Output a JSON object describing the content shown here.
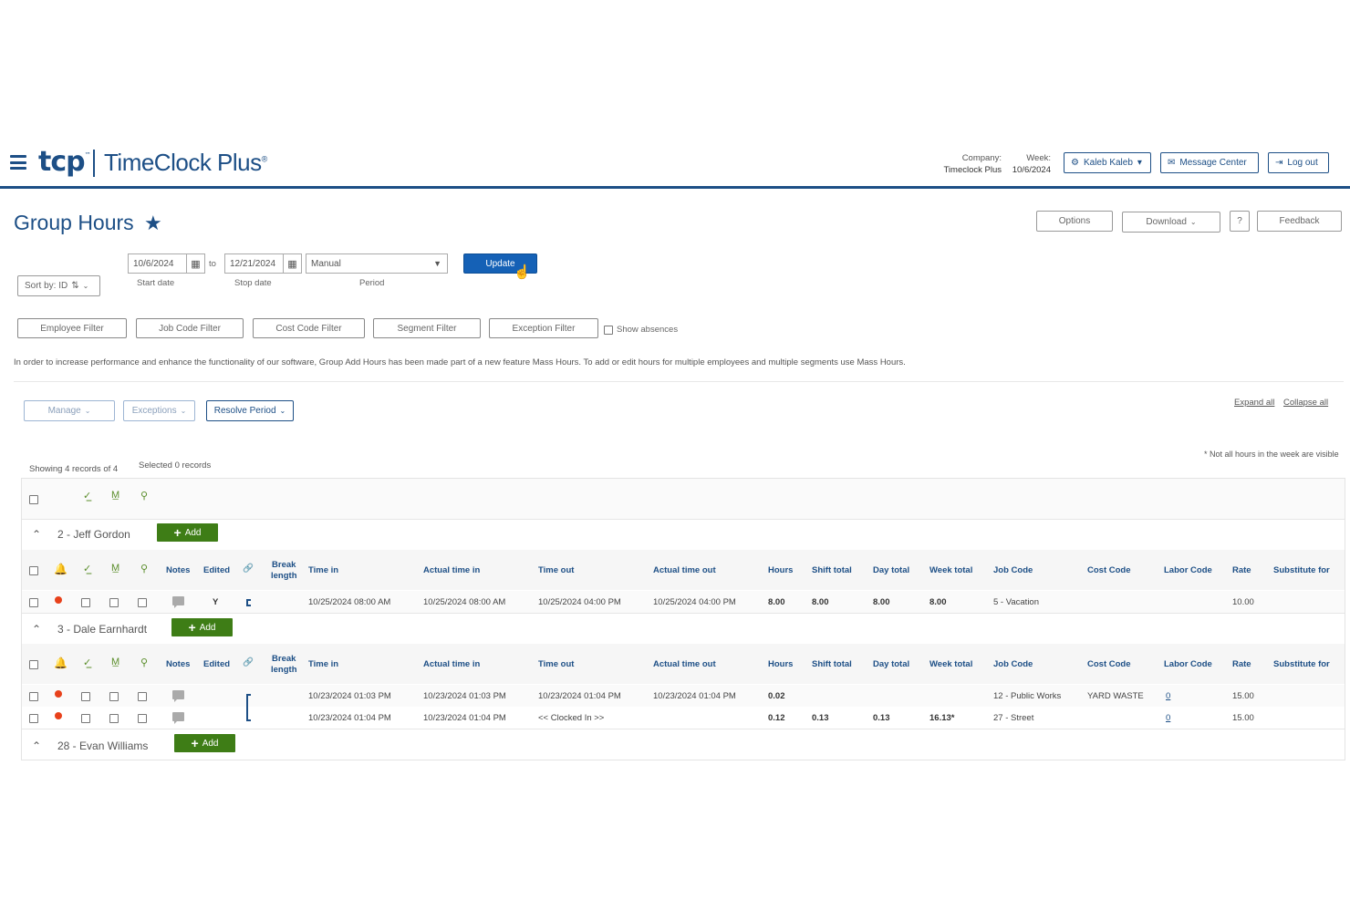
{
  "app": {
    "logo_short": "tcp",
    "logo_name": "TimeClock Plus",
    "company_label": "Company:",
    "company_value": "Timeclock Plus",
    "week_label": "Week:",
    "week_value": "10/6/2024",
    "user_button": "Kaleb Kaleb",
    "message_center": "Message Center",
    "logout": "Log out"
  },
  "page": {
    "title": "Group Hours",
    "options": "Options",
    "download": "Download",
    "help": "?",
    "feedback": "Feedback"
  },
  "filters": {
    "start_date": "10/6/2024",
    "to_label": "to",
    "stop_date": "12/21/2024",
    "period": "Manual",
    "update": "Update",
    "start_label": "Start date",
    "stop_label": "Stop date",
    "period_label": "Period",
    "sort": "Sort by: ID",
    "employee_filter": "Employee Filter",
    "job_code_filter": "Job Code Filter",
    "cost_code_filter": "Cost Code Filter",
    "segment_filter": "Segment Filter",
    "exception_filter": "Exception Filter",
    "show_absences": "Show absences"
  },
  "info": "In order to increase performance and enhance the functionality of our software, Group Add Hours has been made part of a new feature Mass Hours. To add or edit hours for multiple employees and multiple segments use Mass Hours.",
  "actions": {
    "manage": "Manage",
    "exceptions": "Exceptions",
    "resolve_period": "Resolve Period",
    "expand_all": "Expand all",
    "collapse_all": "Collapse all",
    "note": "* Not all hours in the week are visible",
    "showing": "Showing 4 records of 4",
    "selected": "Selected 0 records"
  },
  "columns": {
    "notes": "Notes",
    "edited": "Edited",
    "break_line1": "Break",
    "break_line2": "length",
    "time_in": "Time in",
    "actual_time_in": "Actual time in",
    "time_out": "Time out",
    "actual_time_out": "Actual time out",
    "hours": "Hours",
    "shift_total": "Shift total",
    "day_total": "Day total",
    "week_total": "Week total",
    "job_code": "Job Code",
    "cost_code": "Cost Code",
    "labor_code": "Labor Code",
    "rate": "Rate",
    "substitute_for": "Substitute for"
  },
  "add_label": "Add",
  "groups": [
    {
      "name": "2 - Jeff Gordon",
      "rows": [
        {
          "edited": "Y",
          "time_in": "10/25/2024 08:00 AM",
          "actual_time_in": "10/25/2024 08:00 AM",
          "time_out": "10/25/2024 04:00 PM",
          "actual_time_out": "10/25/2024 04:00 PM",
          "hours": "8.00",
          "shift_total": "8.00",
          "day_total": "8.00",
          "week_total": "8.00",
          "job_code": "5 - Vacation",
          "cost_code": "",
          "labor_code": "",
          "rate": "10.00"
        }
      ]
    },
    {
      "name": "3 - Dale Earnhardt",
      "rows": [
        {
          "edited": "",
          "time_in": "10/23/2024 01:03 PM",
          "actual_time_in": "10/23/2024 01:03 PM",
          "time_out": "10/23/2024 01:04 PM",
          "actual_time_out": "10/23/2024 01:04 PM",
          "hours": "0.02",
          "shift_total": "",
          "day_total": "",
          "week_total": "",
          "job_code": "12 - Public Works",
          "cost_code": "YARD WASTE",
          "labor_code": "0",
          "rate": "15.00"
        },
        {
          "edited": "",
          "time_in": "10/23/2024 01:04 PM",
          "actual_time_in": "10/23/2024 01:04 PM",
          "time_out": "<< Clocked In >>",
          "actual_time_out": "",
          "hours": "0.12",
          "shift_total": "0.13",
          "day_total": "0.13",
          "week_total": "16.13*",
          "job_code": "27 - Street",
          "cost_code": "",
          "labor_code": "0",
          "rate": "15.00"
        }
      ]
    },
    {
      "name": "28 - Evan Williams",
      "rows": []
    }
  ],
  "colors": {
    "brand": "#1d4f86",
    "update": "#1561b6",
    "add": "#3e7d16",
    "alert": "#e8411b"
  }
}
